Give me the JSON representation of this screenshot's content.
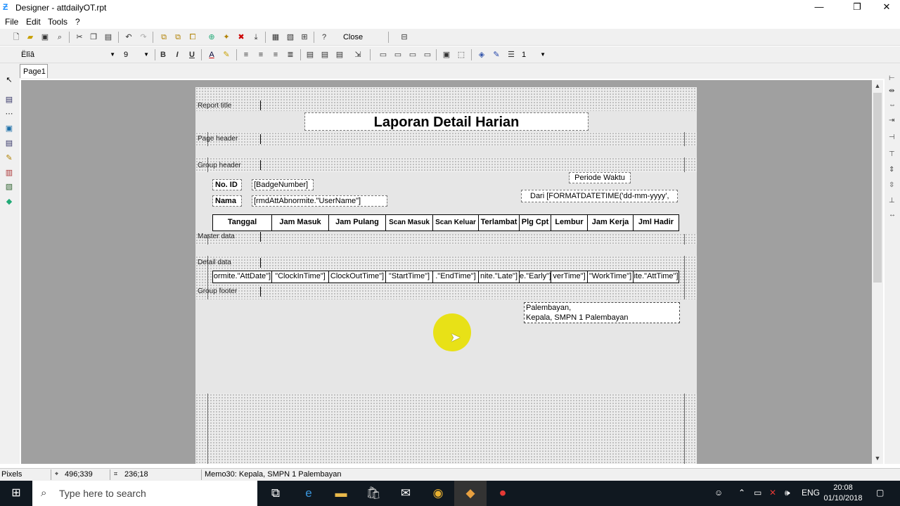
{
  "window": {
    "title": "Designer - attdailyOT.rpt",
    "app_icon": "designer-icon",
    "controls": [
      "—",
      "❐",
      "✕"
    ]
  },
  "menu": [
    "File",
    "Edit",
    "Tools",
    "?"
  ],
  "toolbar1": {
    "close_label": "Close"
  },
  "toolbar2": {
    "font_name": "Ëlîâ",
    "font_size": "9",
    "bold": "B",
    "italic": "I",
    "underline": "U",
    "line_width": "1"
  },
  "tabs": [
    "Page1"
  ],
  "report": {
    "bands": {
      "report_title": "Report title",
      "page_header": "Page header",
      "group_header": "Group header",
      "master_data": "Master data",
      "detail_data": "Detail data",
      "group_footer": "Group footer"
    },
    "title_text": "Laporan Detail Harian",
    "periode_label": "Periode Waktu",
    "periode_value": "Dari [FORMATDATETIME('dd-mm-yyyy',",
    "no_id_label": "No. ID",
    "no_id_value": "[BadgeNumber]",
    "nama_label": "Nama",
    "nama_value": "[rmdAttAbnormite.\"UserName\"]",
    "columns": [
      "Tanggal",
      "Jam Masuk",
      "Jam Pulang",
      "Scan Masuk",
      "Scan Keluar",
      "Terlambat",
      "Plg Cpt",
      "Lembur",
      "Jam Kerja",
      "Jml Hadir"
    ],
    "detail_fields": [
      "ormite.\"AttDate\"]",
      "\"ClockInTime\"]",
      "ClockOutTime\"]",
      "\"StartTime\"]",
      ".\"EndTime\"]",
      "nite.\"Late\"]",
      "e.\"Early\"]",
      "verTime\"]",
      "\"WorkTime\"]",
      "ite.\"AttTime\"]"
    ],
    "footer_line1": "Palembayan,",
    "footer_line2": "Kepala, SMPN 1 Palembayan"
  },
  "status": {
    "units": "Pixels",
    "position": "496;339",
    "size": "236;18",
    "selection": "Memo30: Kepala, SMPN 1 Palembayan"
  },
  "taskbar": {
    "search_placeholder": "Type here to search",
    "language": "ENG",
    "time": "20:08",
    "date": "01/10/2018"
  }
}
